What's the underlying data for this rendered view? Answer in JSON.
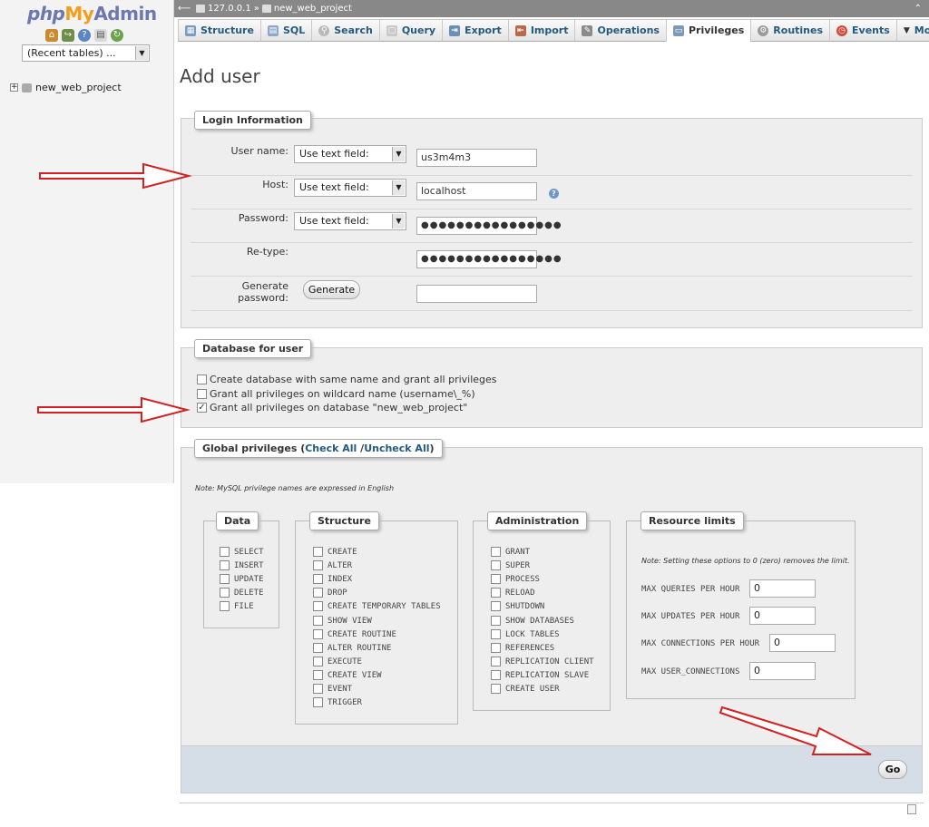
{
  "app": {
    "logo": {
      "php": "php",
      "my": "My",
      "admin": "Admin"
    },
    "recent_tables": "(Recent tables) ...",
    "database": "new_web_project"
  },
  "breadcrumb": {
    "server": "127.0.0.1",
    "separator": "»",
    "database": "new_web_project"
  },
  "tabs": [
    {
      "label": "Structure",
      "icon": "structure-icon"
    },
    {
      "label": "SQL",
      "icon": "sql-icon"
    },
    {
      "label": "Search",
      "icon": "search-icon"
    },
    {
      "label": "Query",
      "icon": "query-icon"
    },
    {
      "label": "Export",
      "icon": "export-icon"
    },
    {
      "label": "Import",
      "icon": "import-icon"
    },
    {
      "label": "Operations",
      "icon": "wrench-icon"
    },
    {
      "label": "Privileges",
      "icon": "privileges-icon",
      "active": true
    },
    {
      "label": "Routines",
      "icon": "routines-icon"
    },
    {
      "label": "Events",
      "icon": "events-icon"
    },
    {
      "label": "More",
      "icon": "chevron-down-icon"
    }
  ],
  "page_title": "Add user",
  "login": {
    "legend": "Login Information",
    "username_label": "User name:",
    "username_mode": "Use text field:",
    "username_value": "us3m4m3",
    "host_label": "Host:",
    "host_mode": "Use text field:",
    "host_value": "localhost",
    "password_label": "Password:",
    "password_mode": "Use text field:",
    "password_value": "●●●●●●●●●●●●●●●●",
    "retype_label": "Re-type:",
    "retype_value": "●●●●●●●●●●●●●●●●",
    "generate_label": "Generate password:",
    "generate_button": "Generate",
    "generated_value": ""
  },
  "database_for_user": {
    "legend": "Database for user",
    "options": [
      {
        "label": "Create database with same name and grant all privileges",
        "checked": false
      },
      {
        "label": "Grant all privileges on wildcard name (username\\_%)",
        "checked": false
      },
      {
        "label": "Grant all privileges on database \"new_web_project\"",
        "checked": true
      }
    ]
  },
  "global": {
    "legend_prefix": "Global privileges (",
    "check_all": "Check All",
    "separator": " /",
    "uncheck_all": "Uncheck All",
    "legend_suffix": ")",
    "note": "Note: MySQL privilege names are expressed in English",
    "data": {
      "legend": "Data",
      "items": [
        "SELECT",
        "INSERT",
        "UPDATE",
        "DELETE",
        "FILE"
      ]
    },
    "structure": {
      "legend": "Structure",
      "items": [
        "CREATE",
        "ALTER",
        "INDEX",
        "DROP",
        "CREATE TEMPORARY TABLES",
        "SHOW VIEW",
        "CREATE ROUTINE",
        "ALTER ROUTINE",
        "EXECUTE",
        "CREATE VIEW",
        "EVENT",
        "TRIGGER"
      ]
    },
    "administration": {
      "legend": "Administration",
      "items": [
        "GRANT",
        "SUPER",
        "PROCESS",
        "RELOAD",
        "SHUTDOWN",
        "SHOW DATABASES",
        "LOCK TABLES",
        "REFERENCES",
        "REPLICATION CLIENT",
        "REPLICATION SLAVE",
        "CREATE USER"
      ]
    },
    "limits": {
      "legend": "Resource limits",
      "note": "Note: Setting these options to 0 (zero) removes the limit.",
      "items": [
        {
          "label": "MAX QUERIES PER HOUR",
          "value": "0"
        },
        {
          "label": "MAX UPDATES PER HOUR",
          "value": "0"
        },
        {
          "label": "MAX CONNECTIONS PER HOUR",
          "value": "0"
        },
        {
          "label": "MAX USER_CONNECTIONS",
          "value": "0"
        }
      ]
    }
  },
  "go_button": "Go",
  "colors": {
    "annotation_arrow": "#d42020",
    "link": "#235a81"
  }
}
